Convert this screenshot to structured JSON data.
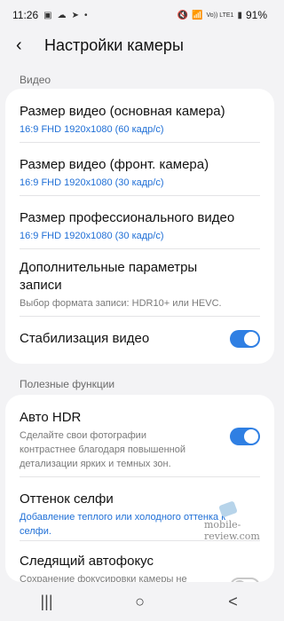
{
  "status": {
    "time": "11:26",
    "icons_left": [
      "image-icon",
      "cloud-icon",
      "send-icon",
      "dot-icon"
    ],
    "icons_right": [
      "mute-icon",
      "wifi-icon",
      "volte-icon",
      "signal-icon"
    ],
    "volte_label": "Vo)) LTE1",
    "battery": "91%"
  },
  "header": {
    "title": "Настройки камеры"
  },
  "sections": {
    "video_label": "Видео",
    "useful_label": "Полезные функции"
  },
  "video": {
    "rear_title": "Размер видео (основная камера)",
    "rear_value": "16:9 FHD 1920x1080 (60 кадр/с)",
    "front_title": "Размер видео (фронт. камера)",
    "front_value": "16:9 FHD 1920x1080 (30 кадр/с)",
    "pro_title": "Размер профессионального видео",
    "pro_value": "16:9 FHD 1920x1080 (30 кадр/с)",
    "advanced_title_line1": "Дополнительные параметры",
    "advanced_title_line2": "записи",
    "advanced_desc": "Выбор формата записи: HDR10+ или HEVC.",
    "stab_title": "Стабилизация видео",
    "stab_on": true
  },
  "useful": {
    "hdr_title": "Авто HDR",
    "hdr_desc_line1": "Сделайте свои фотографии",
    "hdr_desc_line2": "контрастнее благодаря повышенной",
    "hdr_desc_line3": "детализации ярких и темных зон.",
    "hdr_on": true,
    "selfie_title": "Оттенок селфи",
    "selfie_desc_line1": "Добавление теплого или холодного оттенка к",
    "selfie_desc_line2": "селфи.",
    "track_title": "Следящий автофокус",
    "track_desc": "Сохранение фокусировки камеры не",
    "track_on": false
  },
  "watermark": "mobile-review.com",
  "nav": {
    "recent": "|||",
    "home": "○",
    "back": "<"
  }
}
